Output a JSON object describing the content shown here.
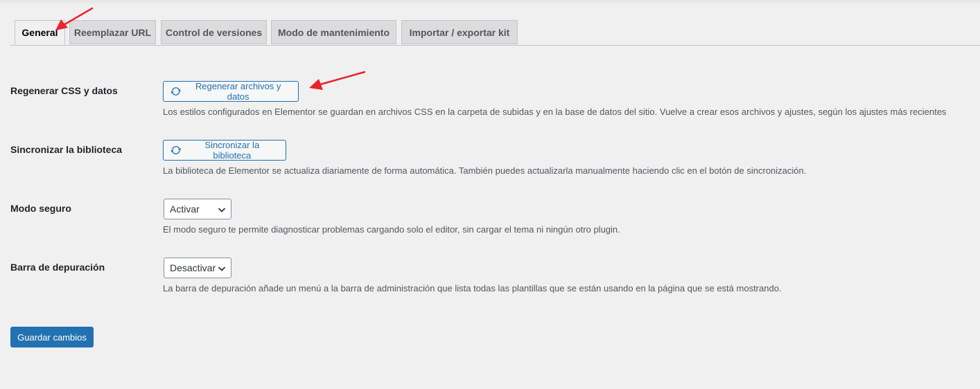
{
  "tabs": [
    {
      "label": "General",
      "active": true
    },
    {
      "label": "Reemplazar URL",
      "active": false
    },
    {
      "label": "Control de versiones",
      "active": false
    },
    {
      "label": "Modo de mantenimiento",
      "active": false
    },
    {
      "label": "Importar / exportar kit",
      "active": false
    }
  ],
  "settings": {
    "regenerate": {
      "label": "Regenerar CSS y datos",
      "button_label": "Regenerar archivos y datos",
      "button_icon": "sync-icon",
      "description": "Los estilos configurados en Elementor se guardan en archivos CSS en la carpeta de subidas y en la base de datos del sitio. Vuelve a crear esos archivos y ajustes, según los ajustes más recientes"
    },
    "sync_library": {
      "label": "Sincronizar la biblioteca",
      "button_label": "Sincronizar la biblioteca",
      "button_icon": "sync-icon",
      "description": "La biblioteca de Elementor se actualiza diariamente de forma automática. También puedes actualizarla manualmente haciendo clic en el botón de sincronización."
    },
    "safe_mode": {
      "label": "Modo seguro",
      "selected": "Activar",
      "description": "El modo seguro te permite diagnosticar problemas cargando solo el editor, sin cargar el tema ni ningún otro plugin."
    },
    "debug_bar": {
      "label": "Barra de depuración",
      "selected": "Desactivar",
      "description": "La barra de depuración añade un menú a la barra de administración que lista todas las plantillas que se están usando en la página que se está mostrando."
    }
  },
  "save_button": "Guardar cambios",
  "colors": {
    "accent": "#2271b1",
    "annotation_arrow": "#e8242a",
    "background": "#f0f0f1"
  }
}
